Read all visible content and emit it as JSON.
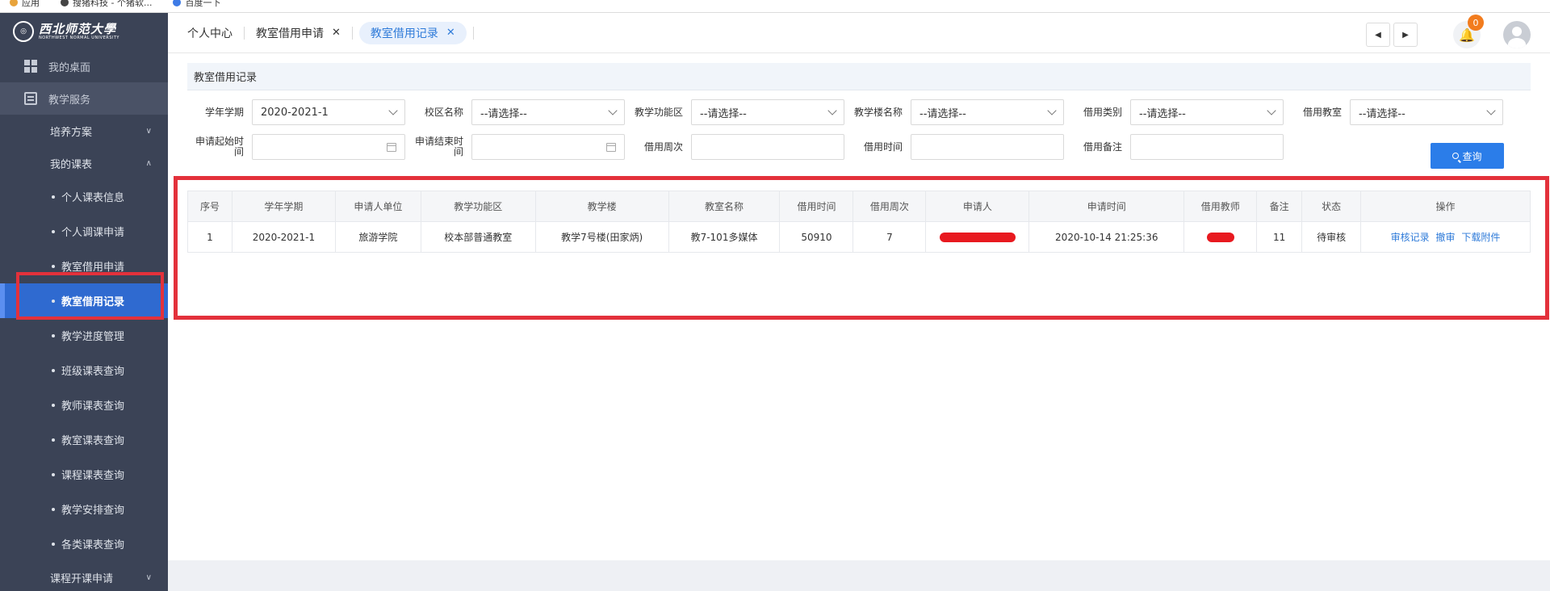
{
  "bookmarks": [
    {
      "label": "应用",
      "icon": "apps-icon"
    },
    {
      "label": "搜猪科技 - 个猪软...",
      "icon": "site-icon"
    },
    {
      "label": "百度一下",
      "icon": "baidu-icon"
    }
  ],
  "sidebar": {
    "logo": {
      "cn": "西北师范大學",
      "en": "NORTHWEST NORMAL UNIVERSITY"
    },
    "top_items": [
      {
        "label": "我的桌面",
        "icon": "windows-icon"
      },
      {
        "label": "教学服务",
        "icon": "list-icon"
      }
    ],
    "groups": [
      {
        "label": "培养方案",
        "expanded": false
      },
      {
        "label": "我的课表",
        "expanded": true
      }
    ],
    "leaves": [
      "个人课表信息",
      "个人调课申请",
      "教室借用申请",
      "教室借用记录",
      "教学进度管理",
      "班级课表查询",
      "教师课表查询",
      "教室课表查询",
      "课程课表查询",
      "教学安排查询",
      "各类课表查询"
    ],
    "current_leaf": "教室借用记录",
    "bottom_group": "课程开课申请"
  },
  "tabs": [
    {
      "label": "个人中心",
      "closable": false
    },
    {
      "label": "教室借用申请",
      "closable": true
    },
    {
      "label": "教室借用记录",
      "closable": true,
      "active": true
    }
  ],
  "notifications": {
    "count": "0"
  },
  "section_title": "教室借用记录",
  "filters": {
    "row1": [
      {
        "label": "学年学期",
        "value": "2020-2021-1",
        "type": "select"
      },
      {
        "label": "校区名称",
        "value": "--请选择--",
        "type": "select"
      },
      {
        "label": "教学功能区",
        "value": "--请选择--",
        "type": "select"
      },
      {
        "label": "教学楼名称",
        "value": "--请选择--",
        "type": "select"
      },
      {
        "label": "借用类别",
        "value": "--请选择--",
        "type": "select"
      },
      {
        "label": "借用教室",
        "value": "--请选择--",
        "type": "select"
      }
    ],
    "row2": [
      {
        "label": "申请起始时间",
        "value": "",
        "type": "date"
      },
      {
        "label": "申请结束时间",
        "value": "",
        "type": "date"
      },
      {
        "label": "借用周次",
        "value": "",
        "type": "text"
      },
      {
        "label": "借用时间",
        "value": "",
        "type": "text"
      },
      {
        "label": "借用备注",
        "value": "",
        "type": "text"
      }
    ],
    "search_label": "查询"
  },
  "table": {
    "headers": [
      "序号",
      "学年学期",
      "申请人单位",
      "教学功能区",
      "教学楼",
      "教室名称",
      "借用时间",
      "借用周次",
      "申请人",
      "申请时间",
      "借用教师",
      "备注",
      "状态",
      "操作"
    ],
    "rows": [
      {
        "cells": [
          "1",
          "2020-2021-1",
          "旅游学院",
          "校本部普通教室",
          "教学7号楼(田家炳)",
          "教7-101多媒体",
          "50910",
          "7",
          "",
          "2020-10-14 21:25:36",
          "",
          "11",
          "待审核"
        ],
        "actions": [
          "审核记录",
          "撤审",
          "下载附件"
        ]
      }
    ]
  },
  "colors": {
    "sidebar_bg": "#3b4356",
    "active_leaf": "#2f6ad0",
    "primary": "#2b7de9",
    "annotation": "#e3313b",
    "badge": "#f27c1e"
  }
}
